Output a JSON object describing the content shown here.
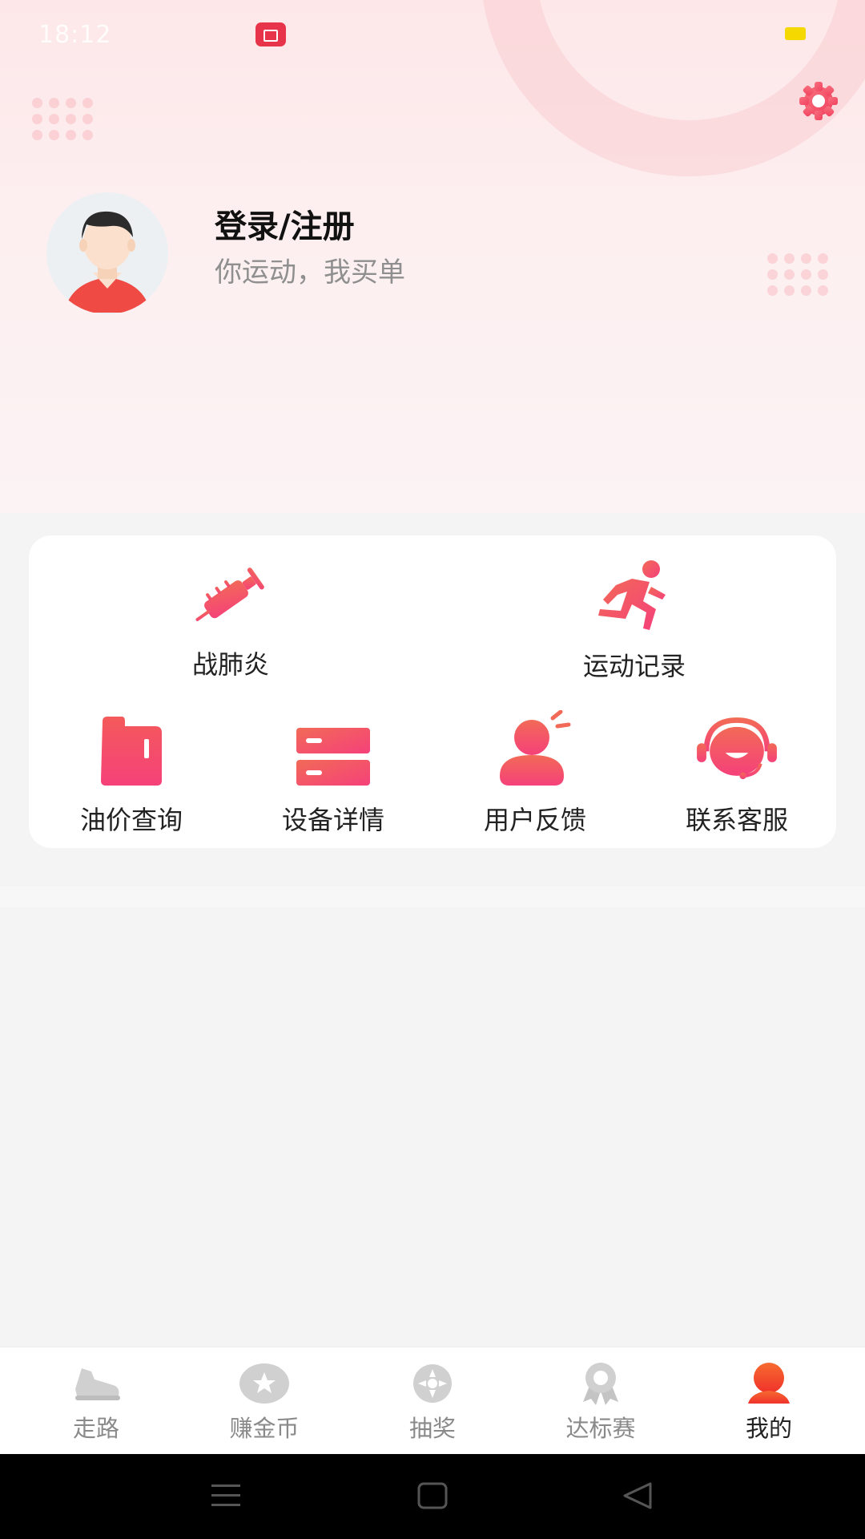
{
  "status_bar": {
    "time": "18:12"
  },
  "profile": {
    "title": "登录/注册",
    "subtitle": "你运动，我买单"
  },
  "menu": {
    "items": [
      {
        "label": "战肺炎",
        "icon": "syringe-icon"
      },
      {
        "label": "运动记录",
        "icon": "running-icon"
      },
      {
        "label": "油价查询",
        "icon": "fuel-can-icon"
      },
      {
        "label": "设备详情",
        "icon": "device-list-icon"
      },
      {
        "label": "用户反馈",
        "icon": "feedback-user-icon"
      },
      {
        "label": "联系客服",
        "icon": "headset-icon"
      }
    ]
  },
  "bottom_nav": {
    "items": [
      {
        "label": "走路",
        "icon": "shoe-icon",
        "active": false
      },
      {
        "label": "赚金币",
        "icon": "coin-icon",
        "active": false
      },
      {
        "label": "抽奖",
        "icon": "lottery-wheel-icon",
        "active": false
      },
      {
        "label": "达标赛",
        "icon": "medal-icon",
        "active": false
      },
      {
        "label": "我的",
        "icon": "user-icon",
        "active": true
      }
    ]
  },
  "colors": {
    "accent": "#f45a6d",
    "accent_gradient_start": "#f26a57",
    "accent_gradient_end": "#f5417a",
    "active_nav": "#f2412f",
    "inactive_icon": "#cfcfcf"
  }
}
